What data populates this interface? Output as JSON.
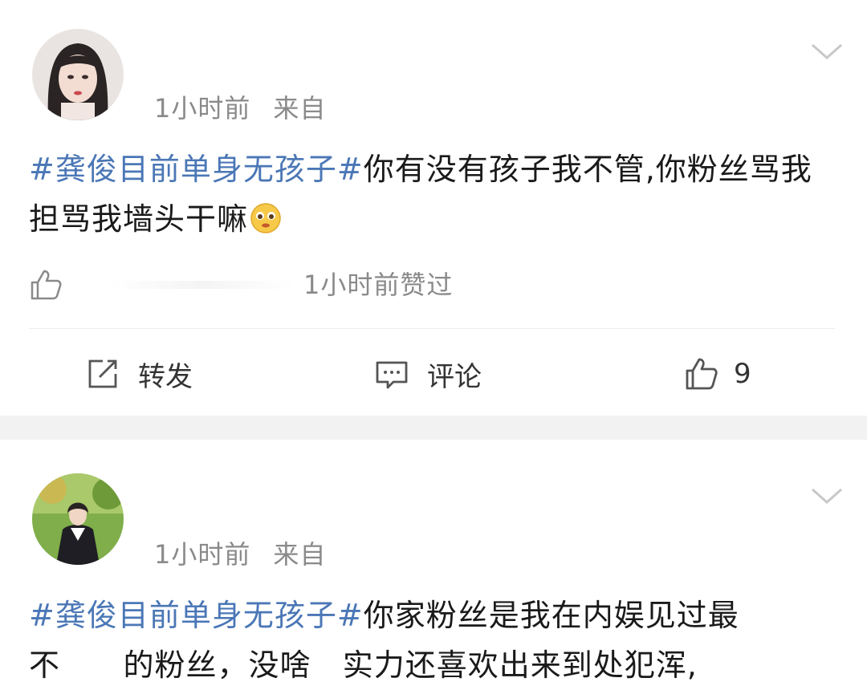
{
  "posts": [
    {
      "time": "1小时前",
      "source": "来自",
      "topic": "#龚俊目前单身无孩子#",
      "text": "你有没有孩子我不管,你粉丝骂我担骂我墙头干嘛",
      "emoji": "pleading-face",
      "liked_info": "1小时前赞过",
      "actions": {
        "repost": "转发",
        "comment": "评论",
        "like_count": "9"
      }
    },
    {
      "time": "1小时前",
      "source": "来自",
      "topic": "#龚俊目前单身无孩子#",
      "text_line1": "你家粉丝是我在内娱见过最",
      "text_line2": "不      的粉丝，没啥   实力还喜欢出来到处犯浑,"
    }
  ],
  "colors": {
    "topic": "#4b77b6",
    "meta": "#8a8a8a",
    "separator": "#f2f2f2"
  }
}
